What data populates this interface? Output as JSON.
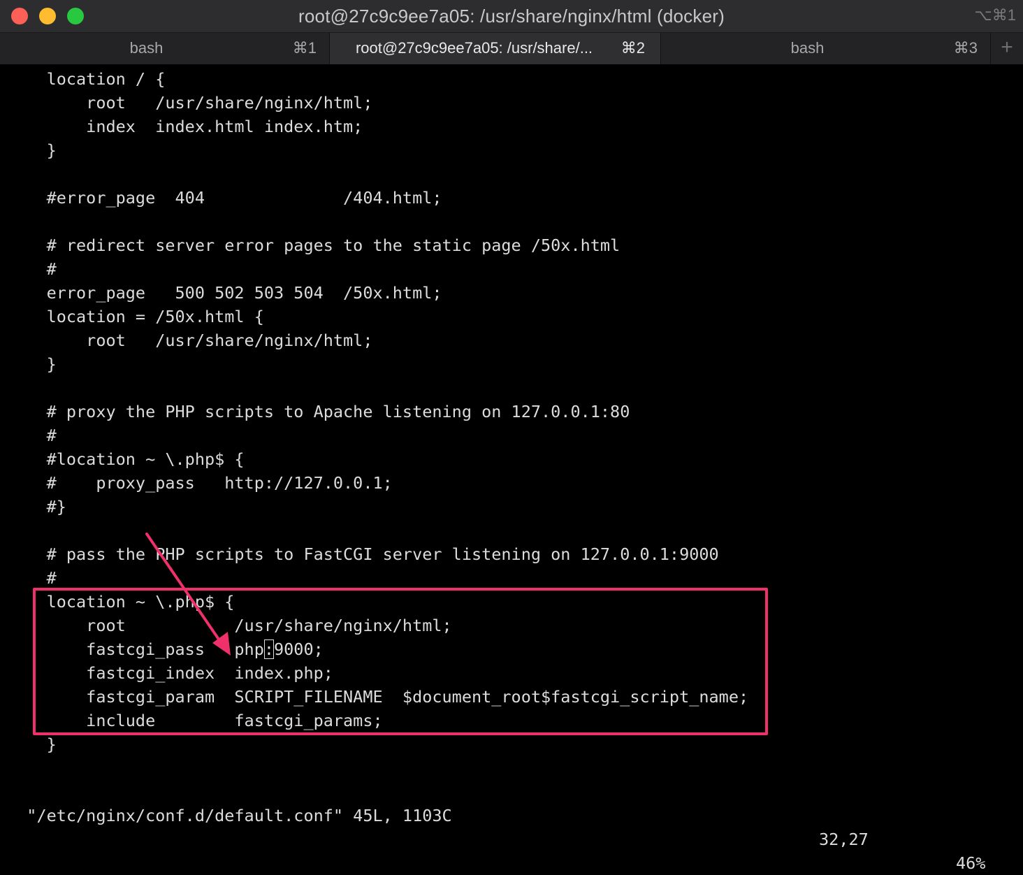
{
  "window": {
    "title": "root@27c9c9ee7a05: /usr/share/nginx/html (docker)",
    "shortcut": "⌥⌘1"
  },
  "tabs": [
    {
      "label": "bash",
      "shortcut": "⌘1"
    },
    {
      "label": "root@27c9c9ee7a05: /usr/share/...",
      "shortcut": "⌘2"
    },
    {
      "label": "bash",
      "shortcut": "⌘3"
    }
  ],
  "new_tab": "+",
  "editor": {
    "lines": [
      "    location / {",
      "        root   /usr/share/nginx/html;",
      "        index  index.html index.htm;",
      "    }",
      "",
      "    #error_page  404              /404.html;",
      "",
      "    # redirect server error pages to the static page /50x.html",
      "    #",
      "    error_page   500 502 503 504  /50x.html;",
      "    location = /50x.html {",
      "        root   /usr/share/nginx/html;",
      "    }",
      "",
      "    # proxy the PHP scripts to Apache listening on 127.0.0.1:80",
      "    #",
      "    #location ~ \\.php$ {",
      "    #    proxy_pass   http://127.0.0.1;",
      "    #}",
      "",
      "    # pass the PHP scripts to FastCGI server listening on 127.0.0.1:9000",
      "    #",
      "    location ~ \\.php$ {",
      "        root           /usr/share/nginx/html;",
      "        fastcgi_pass   php",
      "        fastcgi_index  index.php;",
      "        fastcgi_param  SCRIPT_FILENAME  $document_root$fastcgi_script_name;",
      "        include        fastcgi_params;",
      "    }"
    ],
    "cursor_char": ":",
    "after_cursor": "9000;"
  },
  "status": {
    "file": "\"/etc/nginx/conf.d/default.conf\" 45L, 1103C",
    "position": "32,27",
    "percent": "46%"
  },
  "colors": {
    "highlight": "#f0306a",
    "background": "#000000",
    "text": "#dcdcdc"
  }
}
